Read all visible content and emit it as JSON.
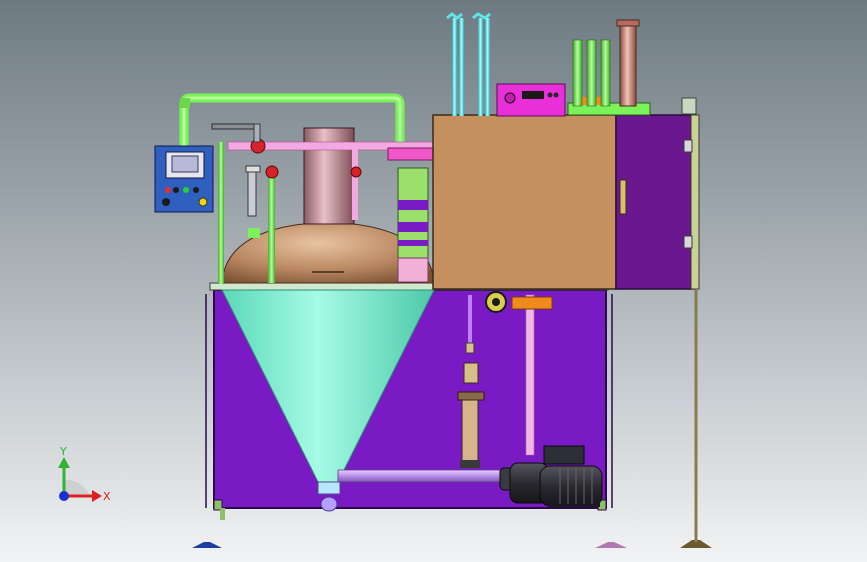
{
  "triad": {
    "x_label": "X",
    "y_label": "Y",
    "x_color": "#e0201c",
    "y_color": "#2fb52f",
    "z_color": "#1a2fd1"
  },
  "colors": {
    "frame_purple": "#7a1ac4",
    "frame_edge": "#2b0a4a",
    "cone": "#6fe8c8",
    "dome": "#b88660",
    "cabinet_front": "#c4915e",
    "cabinet_side": "#6b1890",
    "green_pipe": "#7cf25a",
    "cyan_pipe": "#5ee6e6",
    "pink": "#f28fd4",
    "magenta_box": "#e82fd8",
    "control_panel": "#2f5fbf",
    "motor": "#2a2a30",
    "outlet_pipe": "#c79ff0",
    "copper_column": "#c98a86",
    "column": "#b97f86",
    "orange": "#f08a1c"
  }
}
